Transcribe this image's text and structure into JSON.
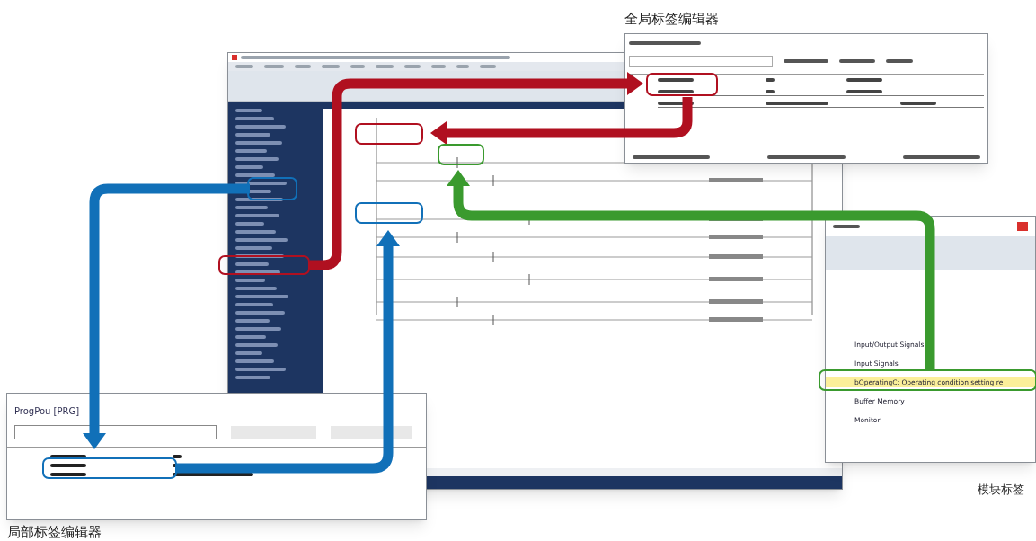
{
  "captions": {
    "global": "全局标签编辑器",
    "module": "模块标签",
    "local": "局部标签编辑器"
  },
  "local_editor": {
    "title": "ProgPou [PRG]"
  },
  "module_tree": {
    "items": [
      {
        "label": "Input/Output Signals",
        "selected": false
      },
      {
        "label": "Input Signals",
        "selected": false
      },
      {
        "label": "bOperatingC: Operating condition setting re",
        "selected": true
      },
      {
        "label": "Buffer Memory",
        "selected": false
      },
      {
        "label": "Monitor",
        "selected": false
      }
    ]
  }
}
